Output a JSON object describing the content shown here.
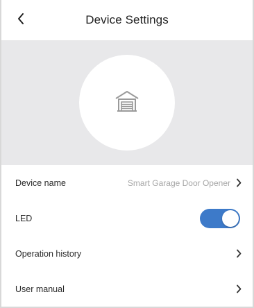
{
  "header": {
    "title": "Device Settings",
    "back_icon": "chevron-left-icon"
  },
  "hero": {
    "device_icon": "garage-icon"
  },
  "settings": {
    "device_name": {
      "label": "Device name",
      "value": "Smart Garage Door Opener"
    },
    "led": {
      "label": "LED",
      "enabled": true
    },
    "operation_history": {
      "label": "Operation history"
    },
    "user_manual": {
      "label": "User manual"
    }
  },
  "colors": {
    "accent": "#3d7ac9",
    "hero_background": "#e8e8ea",
    "secondary_text": "#a6a6a6"
  }
}
